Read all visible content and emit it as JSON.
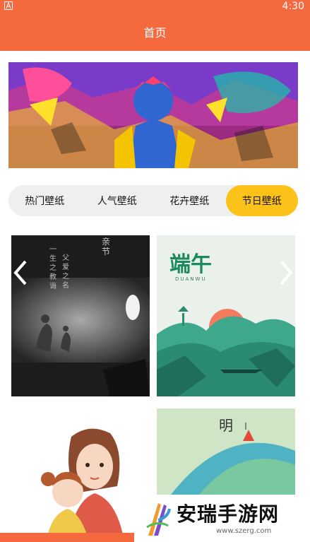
{
  "status_bar": {
    "time": "4:30",
    "icon": "a-icon"
  },
  "header": {
    "title": "首页"
  },
  "tabs": [
    {
      "label": "热门壁纸",
      "active": false
    },
    {
      "label": "人气壁纸",
      "active": false
    },
    {
      "label": "花卉壁纸",
      "active": false
    },
    {
      "label": "节日壁纸",
      "active": true
    }
  ],
  "cards": {
    "card1": {
      "vertical_text": [
        "亲节",
        "父爱之名",
        "一生之教诲"
      ]
    },
    "card2": {
      "title": "端午",
      "subtitle": "DUANWU"
    },
    "card4": {
      "title": "明"
    }
  },
  "watermark": {
    "brand": "安瑞手游网",
    "url": "www.szerg.com"
  },
  "colors": {
    "accent": "#f5693f",
    "tab_active": "#fbc21a"
  }
}
